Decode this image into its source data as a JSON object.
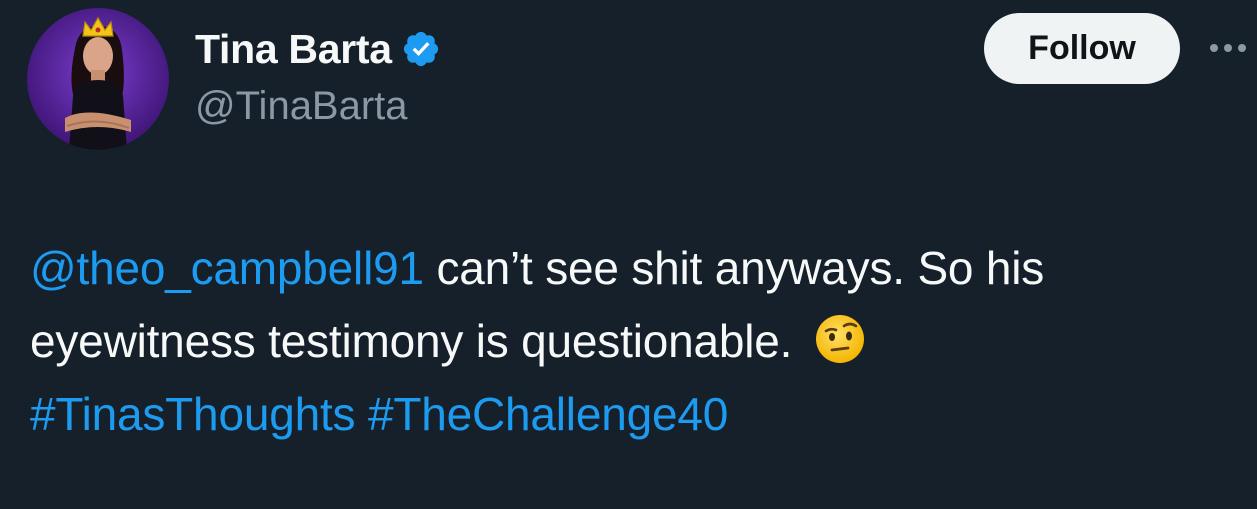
{
  "author": {
    "display_name": "Tina Barta",
    "handle": "@TinaBarta",
    "verified": true,
    "verified_icon": "verified-badge-icon",
    "avatar": "profile-photo-with-crown"
  },
  "actions": {
    "follow_label": "Follow",
    "more_icon": "more-horizontal-icon"
  },
  "tweet": {
    "mention": "@theo_campbell91",
    "line1_text": " can’t see shit anyways.  So his",
    "line2_text": "eyewitness testimony is questionable.",
    "emoji": "face-with-raised-eyebrow-emoji",
    "hashtags": [
      "#TinasThoughts",
      "#TheChallenge40"
    ]
  },
  "colors": {
    "background": "#15202b",
    "link": "#1d9bf0",
    "text": "#f7f9f9",
    "secondary_text": "#8b98a5",
    "follow_button_bg": "#eff3f4",
    "verified": "#1d9bf0"
  }
}
